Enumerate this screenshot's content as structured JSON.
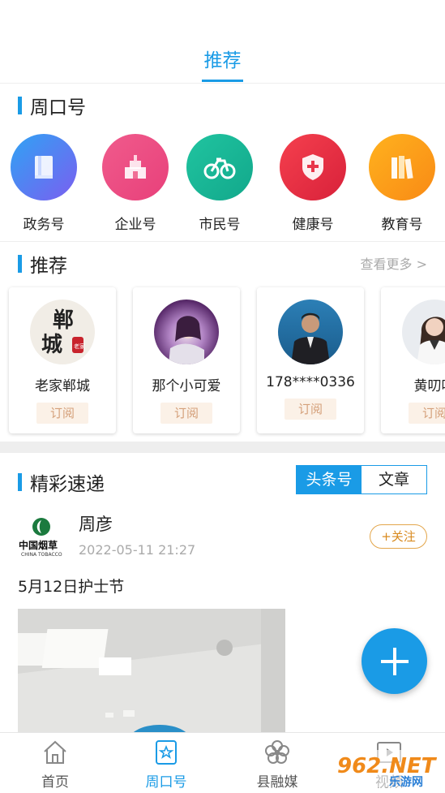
{
  "header": {
    "active_tab": "推荐"
  },
  "zhoukou_section": {
    "title": "周口号",
    "categories": [
      {
        "label": "政务号",
        "icon": "book-icon"
      },
      {
        "label": "企业号",
        "icon": "building-icon"
      },
      {
        "label": "市民号",
        "icon": "bicycle-icon"
      },
      {
        "label": "健康号",
        "icon": "shield-plus-icon"
      },
      {
        "label": "教育号",
        "icon": "books-icon"
      }
    ]
  },
  "recommend_section": {
    "title": "推荐",
    "more_label": "查看更多 >",
    "cards": [
      {
        "name": "老家郸城",
        "subscribe_label": "订阅",
        "logo_text_1": "郸",
        "logo_text_2": "城",
        "logo_seal": "老家"
      },
      {
        "name": "那个小可爱",
        "subscribe_label": "订阅"
      },
      {
        "name": "178****0336",
        "subscribe_label": "订阅"
      },
      {
        "name": "黄叨叨",
        "subscribe_label": "订阅"
      }
    ]
  },
  "highlights_section": {
    "title": "精彩速递",
    "segments": [
      "头条号",
      "文章"
    ]
  },
  "post": {
    "author": "周彦",
    "timestamp": "2022-05-11 21:27",
    "follow_label": "+关注",
    "title": "5月12日护士节",
    "logo_text": "中国烟草",
    "logo_subtext": "CHINA TOBACCO"
  },
  "bottom_nav": [
    {
      "label": "首页",
      "icon": "home-icon",
      "active": false
    },
    {
      "label": "周口号",
      "icon": "star-badge-icon",
      "active": true
    },
    {
      "label": "县融媒",
      "icon": "flower-icon",
      "active": false
    },
    {
      "label": "视频",
      "icon": "video-icon",
      "active": false
    }
  ],
  "watermark": {
    "brand": "962.NET",
    "sub": "乐游网"
  },
  "colors": {
    "accent": "#1a9be6",
    "follow": "#d88a1f",
    "subscribe_text": "#d4a07a"
  }
}
